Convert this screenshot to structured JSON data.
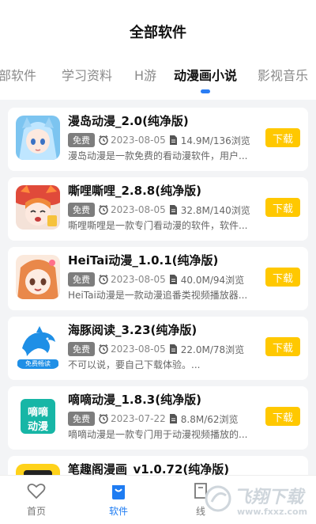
{
  "header": {
    "title": "全部软件"
  },
  "tabs": [
    {
      "label": "全部软件"
    },
    {
      "label": "学习资料"
    },
    {
      "label": "H游"
    },
    {
      "label": "动漫画小说"
    },
    {
      "label": "影视音乐"
    }
  ],
  "active_tab_index": 3,
  "colors": {
    "accent": "#ffc800",
    "active_blue": "#1e7cf2",
    "badge_gray": "#7d7d7d"
  },
  "apps": [
    {
      "name": "漫岛动漫_2.0(纯净版)",
      "badge": "免费",
      "date": "2023-08-05",
      "stats": "14.9M/136浏览",
      "desc": "漫岛动漫是一款免费的看动漫软件，用户...",
      "button": "下载",
      "icon": "anime-girl-blue-icon"
    },
    {
      "name": "嘶哩嘶哩_2.8.8(纯净版)",
      "badge": "免费",
      "date": "2023-08-05",
      "stats": "32.8M/140浏览",
      "desc": "嘶哩嘶哩是一款专门看动漫的软件，软件...",
      "button": "下载",
      "icon": "anime-girl-red-icon"
    },
    {
      "name": "HeiTai动漫_1.0.1(纯净版)",
      "badge": "免费",
      "date": "2023-08-05",
      "stats": "40.0M/94浏览",
      "desc": "HeiTai动漫是一款动漫追番类视频播放器...",
      "button": "下载",
      "icon": "anime-girl-orange-icon"
    },
    {
      "name": "海豚阅读_3.23(纯净版)",
      "badge": "免费",
      "date": "2023-08-05",
      "stats": "22.0M/78浏览",
      "desc": "不可以说，要自己下载体验。...",
      "button": "下载",
      "icon": "dolphin-icon",
      "icon_text": "免费畅读"
    },
    {
      "name": "嘀嘀动漫_1.8.3(纯净版)",
      "badge": "免费",
      "date": "2023-07-22",
      "stats": "8.8M/62浏览",
      "desc": "嘀嘀动漫是一款专门用于动漫视频播放的...",
      "button": "下载",
      "icon": "didi-icon",
      "icon_text_top": "嘀嘀",
      "icon_text_bottom": "动漫"
    },
    {
      "name": "笔趣阁漫画_v1.0.72(纯净版)",
      "badge": "",
      "date": "",
      "stats": "",
      "desc": "",
      "button": "",
      "icon": "biquge-icon"
    }
  ],
  "bottom_nav": [
    {
      "label": "首页",
      "icon": "heart-icon"
    },
    {
      "label": "软件",
      "icon": "bag-icon"
    },
    {
      "label": "线",
      "icon": "book-icon"
    }
  ],
  "watermark": {
    "text": "飞翔下载",
    "url": "www.fxxz.com"
  }
}
